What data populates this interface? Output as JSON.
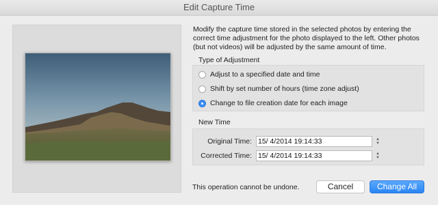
{
  "window": {
    "title": "Edit Capture Time"
  },
  "description": "Modify the capture time stored in the selected photos by entering the correct time adjustment for the photo displayed to the left. Other photos (but not videos) will be adjusted by the same amount of time.",
  "adjustment": {
    "label": "Type of Adjustment",
    "options": [
      {
        "label": "Adjust to a specified date and time",
        "checked": false
      },
      {
        "label": "Shift by set number of hours (time zone adjust)",
        "checked": false
      },
      {
        "label": "Change to file creation date for each image",
        "checked": true
      }
    ]
  },
  "new_time": {
    "label": "New Time",
    "original_label": "Original Time:",
    "original_value": "15/  4/2014 19:14:33",
    "corrected_label": "Corrected Time:",
    "corrected_value": "15/  4/2014 19:14:33"
  },
  "footer": {
    "note": "This operation cannot be undone.",
    "cancel_label": "Cancel",
    "change_all_label": "Change All"
  },
  "colors": {
    "accent": "#3b8ef5",
    "primary_button": "#2a86f5"
  }
}
